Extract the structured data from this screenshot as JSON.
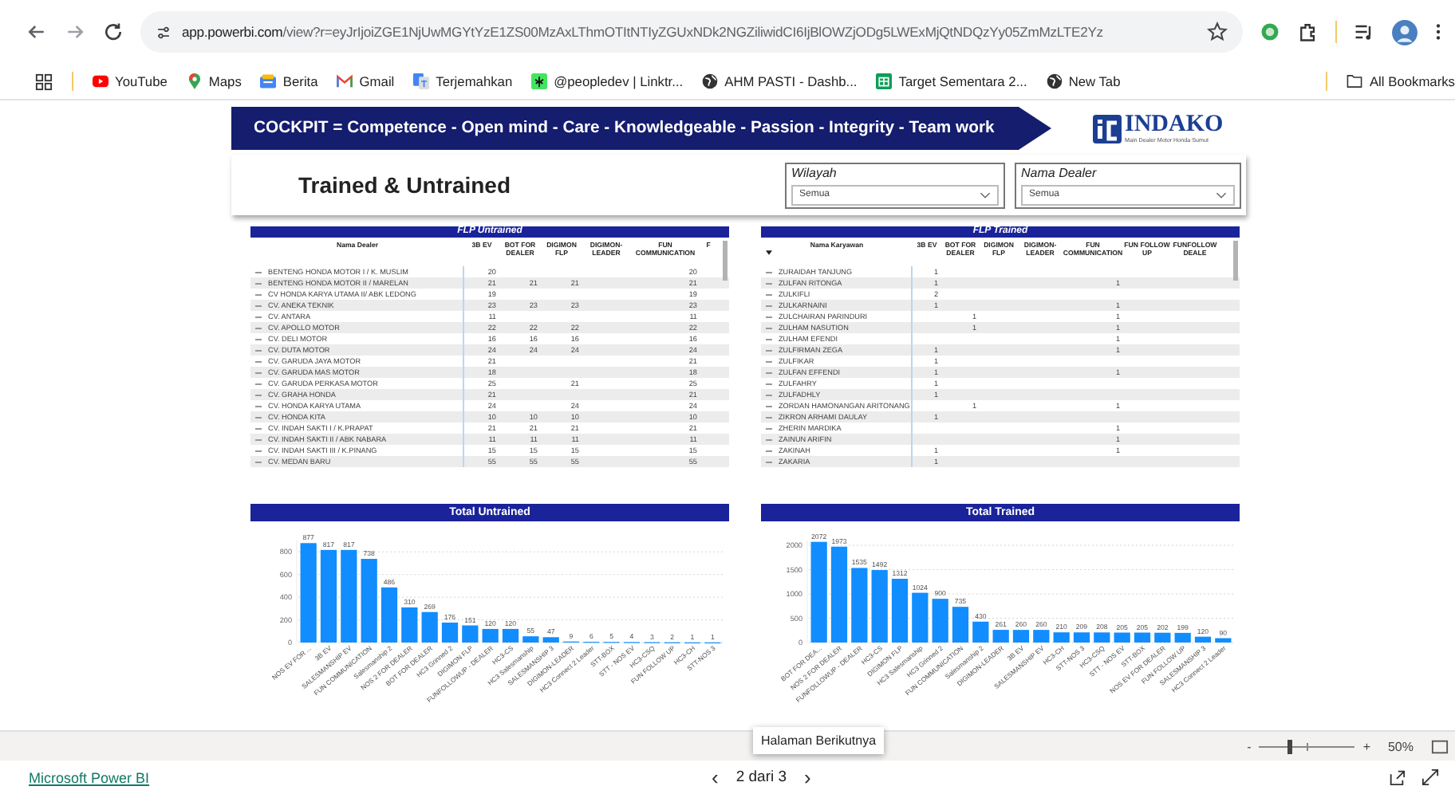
{
  "browser": {
    "url_host": "app.powerbi.com",
    "url_path": "/view?r=eyJrIjoiZGE1NjUwMGYtYzE1ZS00MzAxLThmOTItNTIyZGUxNDk2NGZiliwidCI6IjBlOWZjODg5LWExMjQtNDQzYy05ZmMzLTE2Yz",
    "bookmarks": [
      {
        "kind": "youtube",
        "label": "YouTube"
      },
      {
        "kind": "maps",
        "label": "Maps"
      },
      {
        "kind": "news",
        "label": "Berita"
      },
      {
        "kind": "gmail",
        "label": "Gmail"
      },
      {
        "kind": "translate",
        "label": "Terjemahkan"
      },
      {
        "kind": "linktree",
        "label": "@peopledev | Linktr..."
      },
      {
        "kind": "globe",
        "label": "AHM PASTI - Dashb..."
      },
      {
        "kind": "sheet",
        "label": "Target Sementara 2..."
      },
      {
        "kind": "globe",
        "label": "New Tab"
      }
    ],
    "all_bookmarks": "All Bookmarks"
  },
  "report": {
    "banner": "COCKPIT =  Competence - Open mind - Care - Knowledgeable - Passion - Integrity - Team work",
    "logo": {
      "name": "INDAKO",
      "tagline": "Main Dealer Motor Honda Sumut"
    },
    "title": "Trained & Untrained",
    "slicers": [
      {
        "label": "Wilayah",
        "value": "Semua"
      },
      {
        "label": "Nama Dealer",
        "value": "Semua"
      }
    ],
    "tables": [
      {
        "title": "FLP Untrained",
        "sorted": false,
        "columns": [
          "Nama Dealer",
          "3B EV",
          "BOT FOR DEALER",
          "DIGIMON FLP",
          "DIGIMON-LEADER",
          "FUN COMMUNICATION",
          "F"
        ],
        "rows": [
          [
            "BENTENG HONDA MOTOR I / K. MUSLIM",
            "20",
            null,
            null,
            null,
            "20"
          ],
          [
            "BENTENG HONDA MOTOR II / MARELAN",
            "21",
            "21",
            "21",
            null,
            "21"
          ],
          [
            "CV HONDA KARYA UTAMA II/ ABK LEDONG",
            "19",
            null,
            null,
            null,
            "19"
          ],
          [
            "CV. ANEKA TEKNIK",
            "23",
            "23",
            "23",
            null,
            "23"
          ],
          [
            "CV. ANTARA",
            "11",
            null,
            null,
            null,
            "11"
          ],
          [
            "CV. APOLLO MOTOR",
            "22",
            "22",
            "22",
            null,
            "22"
          ],
          [
            "CV. DELI MOTOR",
            "16",
            "16",
            "16",
            null,
            "16"
          ],
          [
            "CV. DUTA MOTOR",
            "24",
            "24",
            "24",
            null,
            "24"
          ],
          [
            "CV. GARUDA JAYA MOTOR",
            "21",
            null,
            null,
            null,
            "21"
          ],
          [
            "CV. GARUDA MAS MOTOR",
            "18",
            null,
            null,
            null,
            "18"
          ],
          [
            "CV. GARUDA PERKASA MOTOR",
            "25",
            null,
            "21",
            null,
            "25"
          ],
          [
            "CV. GRAHA HONDA",
            "21",
            null,
            null,
            null,
            "21"
          ],
          [
            "CV. HONDA KARYA UTAMA",
            "24",
            null,
            "24",
            null,
            "24"
          ],
          [
            "CV. HONDA KITA",
            "10",
            "10",
            "10",
            null,
            "10"
          ],
          [
            "CV. INDAH SAKTI I / K.PRAPAT",
            "21",
            "21",
            "21",
            null,
            "21"
          ],
          [
            "CV. INDAH SAKTI II / ABK NABARA",
            "11",
            "11",
            "11",
            null,
            "11"
          ],
          [
            "CV. INDAH SAKTI III / K.PINANG",
            "15",
            "15",
            "15",
            null,
            "15"
          ],
          [
            "CV. MEDAN BARU",
            "55",
            "55",
            "55",
            null,
            "55"
          ]
        ]
      },
      {
        "title": "FLP Trained",
        "sorted": true,
        "columns": [
          "Nama Karyawan",
          "3B EV",
          "BOT FOR DEALER",
          "DIGIMON FLP",
          "DIGIMON-LEADER",
          "FUN COMMUNICATION",
          "FUN FOLLOW UP",
          "FUNFOLLOW DEALE"
        ],
        "rows": [
          [
            "ZURAIDAH TANJUNG",
            "1",
            null,
            null,
            null,
            null,
            null,
            null
          ],
          [
            "ZULFAN RITONGA",
            "1",
            null,
            null,
            null,
            "1",
            null,
            null
          ],
          [
            "ZULKIFLI",
            "2",
            null,
            null,
            null,
            null,
            null,
            null
          ],
          [
            "ZULKARNAINI",
            "1",
            null,
            null,
            null,
            "1",
            null,
            null
          ],
          [
            "ZULCHAIRAN PARINDURI",
            null,
            "1",
            null,
            null,
            "1",
            null,
            null
          ],
          [
            "ZULHAM NASUTION",
            null,
            "1",
            null,
            null,
            "1",
            null,
            null
          ],
          [
            "ZULHAM EFENDI",
            null,
            null,
            null,
            null,
            "1",
            null,
            null
          ],
          [
            "ZULFIRMAN ZEGA",
            "1",
            null,
            null,
            null,
            "1",
            null,
            null
          ],
          [
            "ZULFIKAR",
            "1",
            null,
            null,
            null,
            null,
            null,
            null
          ],
          [
            "ZULFAN EFFENDI",
            "1",
            null,
            null,
            null,
            "1",
            null,
            null
          ],
          [
            "ZULFAHRY",
            "1",
            null,
            null,
            null,
            null,
            null,
            null
          ],
          [
            "ZULFADHLY",
            "1",
            null,
            null,
            null,
            null,
            null,
            null
          ],
          [
            "ZORDAN HAMONANGAN ARITONANG",
            null,
            "1",
            null,
            null,
            "1",
            null,
            null
          ],
          [
            "ZIKRON ARHAMI DAULAY",
            "1",
            null,
            null,
            null,
            null,
            null,
            null
          ],
          [
            "ZHERIN MARDIKA",
            null,
            null,
            null,
            null,
            "1",
            null,
            null
          ],
          [
            "ZAINUN ARIFIN",
            null,
            null,
            null,
            null,
            "1",
            null,
            null
          ],
          [
            "ZAKINAH",
            "1",
            null,
            null,
            null,
            "1",
            null,
            null
          ],
          [
            "ZAKARIA",
            "1",
            null,
            null,
            null,
            null,
            null,
            null
          ]
        ]
      }
    ],
    "charts": [
      {
        "title": "Total Untrained",
        "chart_data": {
          "type": "bar",
          "categories": [
            "NOS EV FOR ...",
            "3B EV",
            "SALESMANSHIP EV",
            "FUN COMMUNICATION",
            "Salesmanship 2",
            "NOS 2 FOR DEALER",
            "BOT FOR DEALER",
            "HC3 Grinned 2",
            "DIGIMON FLP",
            "FUNFOLLOWUP - DEALER",
            "HC3-CS",
            "HC3 Salesmanship",
            "SALESMANSHIP 3",
            "DIGIMON-LEADER",
            "HC3 Connect 2 Leader",
            "STT-BOX",
            "STT - NOS EV",
            "HC3-CSQ",
            "FUN FOLLOW UP",
            "HC3-CH",
            "STT-NOS 3"
          ],
          "values": [
            877,
            817,
            817,
            738,
            486,
            310,
            269,
            176,
            151,
            120,
            120,
            55,
            47,
            9,
            6,
            5,
            4,
            3,
            2,
            1,
            1
          ],
          "ylim": [
            0,
            900
          ],
          "yticks": [
            0,
            200,
            400,
            600,
            800
          ],
          "grid": true,
          "data_labels": true
        }
      },
      {
        "title": "Total Trained",
        "chart_data": {
          "type": "bar",
          "categories": [
            "BOT FOR DEA...",
            "NOS 2 FOR DEALER",
            "FUNFOLLOWUP - DEALER",
            "HC3-CS",
            "DIGIMON FLP",
            "HC3 Salesmanship",
            "HC3 Grinned 2",
            "FUN COMMUNICATION",
            "Salesmanship 2",
            "DIGIMON-LEADER",
            "3B EV",
            "SALESMANSHIP EV",
            "HC3-CH",
            "STT-NOS 3",
            "HC3-CSQ",
            "STT - NOS EV",
            "STT-BOX",
            "NOS EV FOR DEALER",
            "FUN FOLLOW UP",
            "SALESMANSHIP 3",
            "HC3 Connect 2 Leader"
          ],
          "values": [
            2072,
            1973,
            1535,
            1492,
            1312,
            1024,
            900,
            735,
            430,
            261,
            260,
            260,
            210,
            209,
            208,
            205,
            205,
            202,
            199,
            120,
            90
          ],
          "ylim": [
            0,
            2100
          ],
          "yticks": [
            0,
            500,
            1000,
            1500,
            2000
          ],
          "grid": true,
          "data_labels": true
        }
      }
    ]
  },
  "footer": {
    "zoom": {
      "minus": "-",
      "plus": "+",
      "value": "50%",
      "level": 0.3
    },
    "brand": "Microsoft Power BI",
    "prev": "‹",
    "page": "2 dari 3",
    "next": "›",
    "tooltip": "Halaman Berikutnya"
  }
}
